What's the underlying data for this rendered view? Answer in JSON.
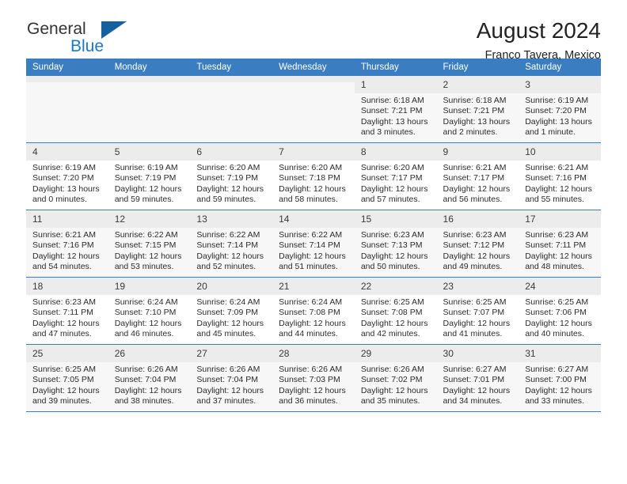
{
  "brand": {
    "name_part1": "General",
    "name_part2": "Blue",
    "logo_icon": "triangle-logo-icon"
  },
  "header": {
    "title": "August 2024",
    "subtitle": "Franco Tavera, Mexico"
  },
  "calendar": {
    "weekday_headers": [
      "Sunday",
      "Monday",
      "Tuesday",
      "Wednesday",
      "Thursday",
      "Friday",
      "Saturday"
    ],
    "colors": {
      "header_blue": "#3a7dc0",
      "row_separator": "#3a7dc0",
      "daynum_band": "#ececec",
      "alt_row": "#f7f7f7",
      "brand_blue": "#1c79c0"
    },
    "weeks": [
      [
        {
          "day": "",
          "empty": true,
          "sunrise": "",
          "sunset": "",
          "daylight1": "",
          "daylight2": ""
        },
        {
          "day": "",
          "empty": true,
          "sunrise": "",
          "sunset": "",
          "daylight1": "",
          "daylight2": ""
        },
        {
          "day": "",
          "empty": true,
          "sunrise": "",
          "sunset": "",
          "daylight1": "",
          "daylight2": ""
        },
        {
          "day": "",
          "empty": true,
          "sunrise": "",
          "sunset": "",
          "daylight1": "",
          "daylight2": ""
        },
        {
          "day": "1",
          "sunrise": "Sunrise: 6:18 AM",
          "sunset": "Sunset: 7:21 PM",
          "daylight1": "Daylight: 13 hours",
          "daylight2": "and 3 minutes."
        },
        {
          "day": "2",
          "sunrise": "Sunrise: 6:18 AM",
          "sunset": "Sunset: 7:21 PM",
          "daylight1": "Daylight: 13 hours",
          "daylight2": "and 2 minutes."
        },
        {
          "day": "3",
          "sunrise": "Sunrise: 6:19 AM",
          "sunset": "Sunset: 7:20 PM",
          "daylight1": "Daylight: 13 hours",
          "daylight2": "and 1 minute."
        }
      ],
      [
        {
          "day": "4",
          "sunrise": "Sunrise: 6:19 AM",
          "sunset": "Sunset: 7:20 PM",
          "daylight1": "Daylight: 13 hours",
          "daylight2": "and 0 minutes."
        },
        {
          "day": "5",
          "sunrise": "Sunrise: 6:19 AM",
          "sunset": "Sunset: 7:19 PM",
          "daylight1": "Daylight: 12 hours",
          "daylight2": "and 59 minutes."
        },
        {
          "day": "6",
          "sunrise": "Sunrise: 6:20 AM",
          "sunset": "Sunset: 7:19 PM",
          "daylight1": "Daylight: 12 hours",
          "daylight2": "and 59 minutes."
        },
        {
          "day": "7",
          "sunrise": "Sunrise: 6:20 AM",
          "sunset": "Sunset: 7:18 PM",
          "daylight1": "Daylight: 12 hours",
          "daylight2": "and 58 minutes."
        },
        {
          "day": "8",
          "sunrise": "Sunrise: 6:20 AM",
          "sunset": "Sunset: 7:17 PM",
          "daylight1": "Daylight: 12 hours",
          "daylight2": "and 57 minutes."
        },
        {
          "day": "9",
          "sunrise": "Sunrise: 6:21 AM",
          "sunset": "Sunset: 7:17 PM",
          "daylight1": "Daylight: 12 hours",
          "daylight2": "and 56 minutes."
        },
        {
          "day": "10",
          "sunrise": "Sunrise: 6:21 AM",
          "sunset": "Sunset: 7:16 PM",
          "daylight1": "Daylight: 12 hours",
          "daylight2": "and 55 minutes."
        }
      ],
      [
        {
          "day": "11",
          "sunrise": "Sunrise: 6:21 AM",
          "sunset": "Sunset: 7:16 PM",
          "daylight1": "Daylight: 12 hours",
          "daylight2": "and 54 minutes."
        },
        {
          "day": "12",
          "sunrise": "Sunrise: 6:22 AM",
          "sunset": "Sunset: 7:15 PM",
          "daylight1": "Daylight: 12 hours",
          "daylight2": "and 53 minutes."
        },
        {
          "day": "13",
          "sunrise": "Sunrise: 6:22 AM",
          "sunset": "Sunset: 7:14 PM",
          "daylight1": "Daylight: 12 hours",
          "daylight2": "and 52 minutes."
        },
        {
          "day": "14",
          "sunrise": "Sunrise: 6:22 AM",
          "sunset": "Sunset: 7:14 PM",
          "daylight1": "Daylight: 12 hours",
          "daylight2": "and 51 minutes."
        },
        {
          "day": "15",
          "sunrise": "Sunrise: 6:23 AM",
          "sunset": "Sunset: 7:13 PM",
          "daylight1": "Daylight: 12 hours",
          "daylight2": "and 50 minutes."
        },
        {
          "day": "16",
          "sunrise": "Sunrise: 6:23 AM",
          "sunset": "Sunset: 7:12 PM",
          "daylight1": "Daylight: 12 hours",
          "daylight2": "and 49 minutes."
        },
        {
          "day": "17",
          "sunrise": "Sunrise: 6:23 AM",
          "sunset": "Sunset: 7:11 PM",
          "daylight1": "Daylight: 12 hours",
          "daylight2": "and 48 minutes."
        }
      ],
      [
        {
          "day": "18",
          "sunrise": "Sunrise: 6:23 AM",
          "sunset": "Sunset: 7:11 PM",
          "daylight1": "Daylight: 12 hours",
          "daylight2": "and 47 minutes."
        },
        {
          "day": "19",
          "sunrise": "Sunrise: 6:24 AM",
          "sunset": "Sunset: 7:10 PM",
          "daylight1": "Daylight: 12 hours",
          "daylight2": "and 46 minutes."
        },
        {
          "day": "20",
          "sunrise": "Sunrise: 6:24 AM",
          "sunset": "Sunset: 7:09 PM",
          "daylight1": "Daylight: 12 hours",
          "daylight2": "and 45 minutes."
        },
        {
          "day": "21",
          "sunrise": "Sunrise: 6:24 AM",
          "sunset": "Sunset: 7:08 PM",
          "daylight1": "Daylight: 12 hours",
          "daylight2": "and 44 minutes."
        },
        {
          "day": "22",
          "sunrise": "Sunrise: 6:25 AM",
          "sunset": "Sunset: 7:08 PM",
          "daylight1": "Daylight: 12 hours",
          "daylight2": "and 42 minutes."
        },
        {
          "day": "23",
          "sunrise": "Sunrise: 6:25 AM",
          "sunset": "Sunset: 7:07 PM",
          "daylight1": "Daylight: 12 hours",
          "daylight2": "and 41 minutes."
        },
        {
          "day": "24",
          "sunrise": "Sunrise: 6:25 AM",
          "sunset": "Sunset: 7:06 PM",
          "daylight1": "Daylight: 12 hours",
          "daylight2": "and 40 minutes."
        }
      ],
      [
        {
          "day": "25",
          "sunrise": "Sunrise: 6:25 AM",
          "sunset": "Sunset: 7:05 PM",
          "daylight1": "Daylight: 12 hours",
          "daylight2": "and 39 minutes."
        },
        {
          "day": "26",
          "sunrise": "Sunrise: 6:26 AM",
          "sunset": "Sunset: 7:04 PM",
          "daylight1": "Daylight: 12 hours",
          "daylight2": "and 38 minutes."
        },
        {
          "day": "27",
          "sunrise": "Sunrise: 6:26 AM",
          "sunset": "Sunset: 7:04 PM",
          "daylight1": "Daylight: 12 hours",
          "daylight2": "and 37 minutes."
        },
        {
          "day": "28",
          "sunrise": "Sunrise: 6:26 AM",
          "sunset": "Sunset: 7:03 PM",
          "daylight1": "Daylight: 12 hours",
          "daylight2": "and 36 minutes."
        },
        {
          "day": "29",
          "sunrise": "Sunrise: 6:26 AM",
          "sunset": "Sunset: 7:02 PM",
          "daylight1": "Daylight: 12 hours",
          "daylight2": "and 35 minutes."
        },
        {
          "day": "30",
          "sunrise": "Sunrise: 6:27 AM",
          "sunset": "Sunset: 7:01 PM",
          "daylight1": "Daylight: 12 hours",
          "daylight2": "and 34 minutes."
        },
        {
          "day": "31",
          "sunrise": "Sunrise: 6:27 AM",
          "sunset": "Sunset: 7:00 PM",
          "daylight1": "Daylight: 12 hours",
          "daylight2": "and 33 minutes."
        }
      ]
    ]
  }
}
